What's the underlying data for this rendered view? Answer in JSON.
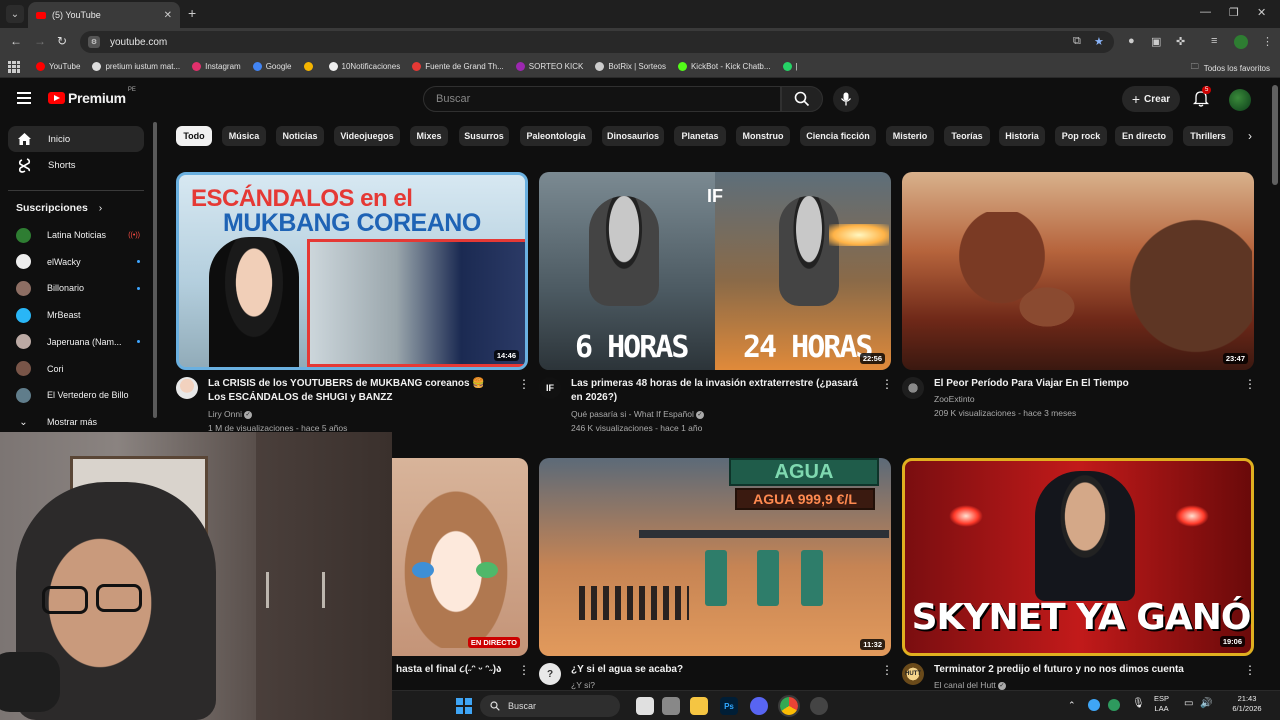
{
  "browser": {
    "tab_title": "(5) YouTube",
    "url": "youtube.com",
    "bookmarks": [
      {
        "label": "YouTube",
        "color": "#ff0000"
      },
      {
        "label": "pretium iustum mat...",
        "color": "#dddddd"
      },
      {
        "label": "Instagram",
        "color": "#e1306c"
      },
      {
        "label": "Google",
        "color": "#4285f4"
      },
      {
        "label": "",
        "color": "#f4b400"
      },
      {
        "label": "10Notificaciones",
        "color": "#eeeeee"
      },
      {
        "label": "Fuente de Grand Th...",
        "color": "#e53935"
      },
      {
        "label": "SORTEO KICK",
        "color": "#9c27b0"
      },
      {
        "label": "BotRix | Sorteos",
        "color": "#cccccc"
      },
      {
        "label": "KickBot - Kick Chatb...",
        "color": "#53fc18"
      },
      {
        "label": "|",
        "color": "#25d366"
      }
    ],
    "all_bookmarks": "Todos los favoritos"
  },
  "header": {
    "logo_text": "Premium",
    "region": "PE",
    "search_placeholder": "Buscar",
    "create_label": "Crear",
    "notif_count": "5"
  },
  "sidebar": {
    "items": [
      {
        "label": "Inicio"
      },
      {
        "label": "Shorts"
      }
    ],
    "subs_heading": "Suscripciones",
    "subscriptions": [
      {
        "label": "Latina Noticias",
        "color": "#2e7d32",
        "indicator": "live"
      },
      {
        "label": "elWacky",
        "color": "#eeeeee",
        "indicator": "dot"
      },
      {
        "label": "Billonario",
        "color": "#8d6e63",
        "indicator": "dot"
      },
      {
        "label": "MrBeast",
        "color": "#29b6f6",
        "indicator": "none"
      },
      {
        "label": "Japeruana (Nam...",
        "color": "#bcaaa4",
        "indicator": "dot"
      },
      {
        "label": "Cori",
        "color": "#795548",
        "indicator": "none"
      },
      {
        "label": "El Vertedero de Billo",
        "color": "#607d8b",
        "indicator": "none"
      }
    ],
    "show_more": "Mostrar más"
  },
  "chips": [
    "Todo",
    "Música",
    "Noticias",
    "Videojuegos",
    "Mixes",
    "Susurros",
    "Paleontología",
    "Dinosaurios",
    "Planetas",
    "Monstruo",
    "Ciencia ficción",
    "Misterio",
    "Teorías",
    "Historia",
    "Pop rock",
    "En directo",
    "Thrillers"
  ],
  "videos": [
    {
      "title": "La CRISIS de los YOUTUBERS de MUKBANG coreanos 🍔 Los ESCÁNDALOS de SHUGI y BANZZ",
      "channel": "Liry Onni",
      "meta": "1 M de visualizaciones - hace 5 años",
      "duration": "14:46",
      "thumb_text": [
        "ESCÁNDALOS en el",
        "MUKBANG COREANO"
      ]
    },
    {
      "title": "Las primeras 48 horas de la invasión extraterrestre (¿pasará en 2026?)",
      "channel": "Qué pasaría si - What If Español",
      "meta": "246 K visualizaciones - hace 1 año",
      "duration": "22:56",
      "thumb_text": [
        "6 HORAS",
        "24 HORAS",
        "IF"
      ]
    },
    {
      "title": "El Peor Período Para Viajar En El Tiempo",
      "channel": "ZooExtinto",
      "meta": "209 K visualizaciones - hace 3 meses",
      "duration": "23:47",
      "thumb_text": []
    },
    {
      "title": "hasta el final ૮(˶ᵔ ᵕ ᵔ˶)ა",
      "channel": "",
      "meta": "",
      "duration": "",
      "live_label": "EN DIRECTO",
      "thumb_text": []
    },
    {
      "title": "¿Y si el agua se acaba?",
      "channel": "¿Y si?",
      "meta": "",
      "duration": "11:32",
      "thumb_text": [
        "AGUA",
        "AGUA 999,9 €/L"
      ]
    },
    {
      "title": "Terminator 2 predijo el futuro y no nos dimos cuenta",
      "channel": "El canal del Hutt",
      "meta": "",
      "duration": "19:06",
      "thumb_text": [
        "SKYNET YA GANÓ"
      ]
    }
  ],
  "taskbar": {
    "search_placeholder": "Buscar",
    "lang": "ESP",
    "lang2": "LAA",
    "time": "21:43",
    "date": "6/1/2026"
  }
}
